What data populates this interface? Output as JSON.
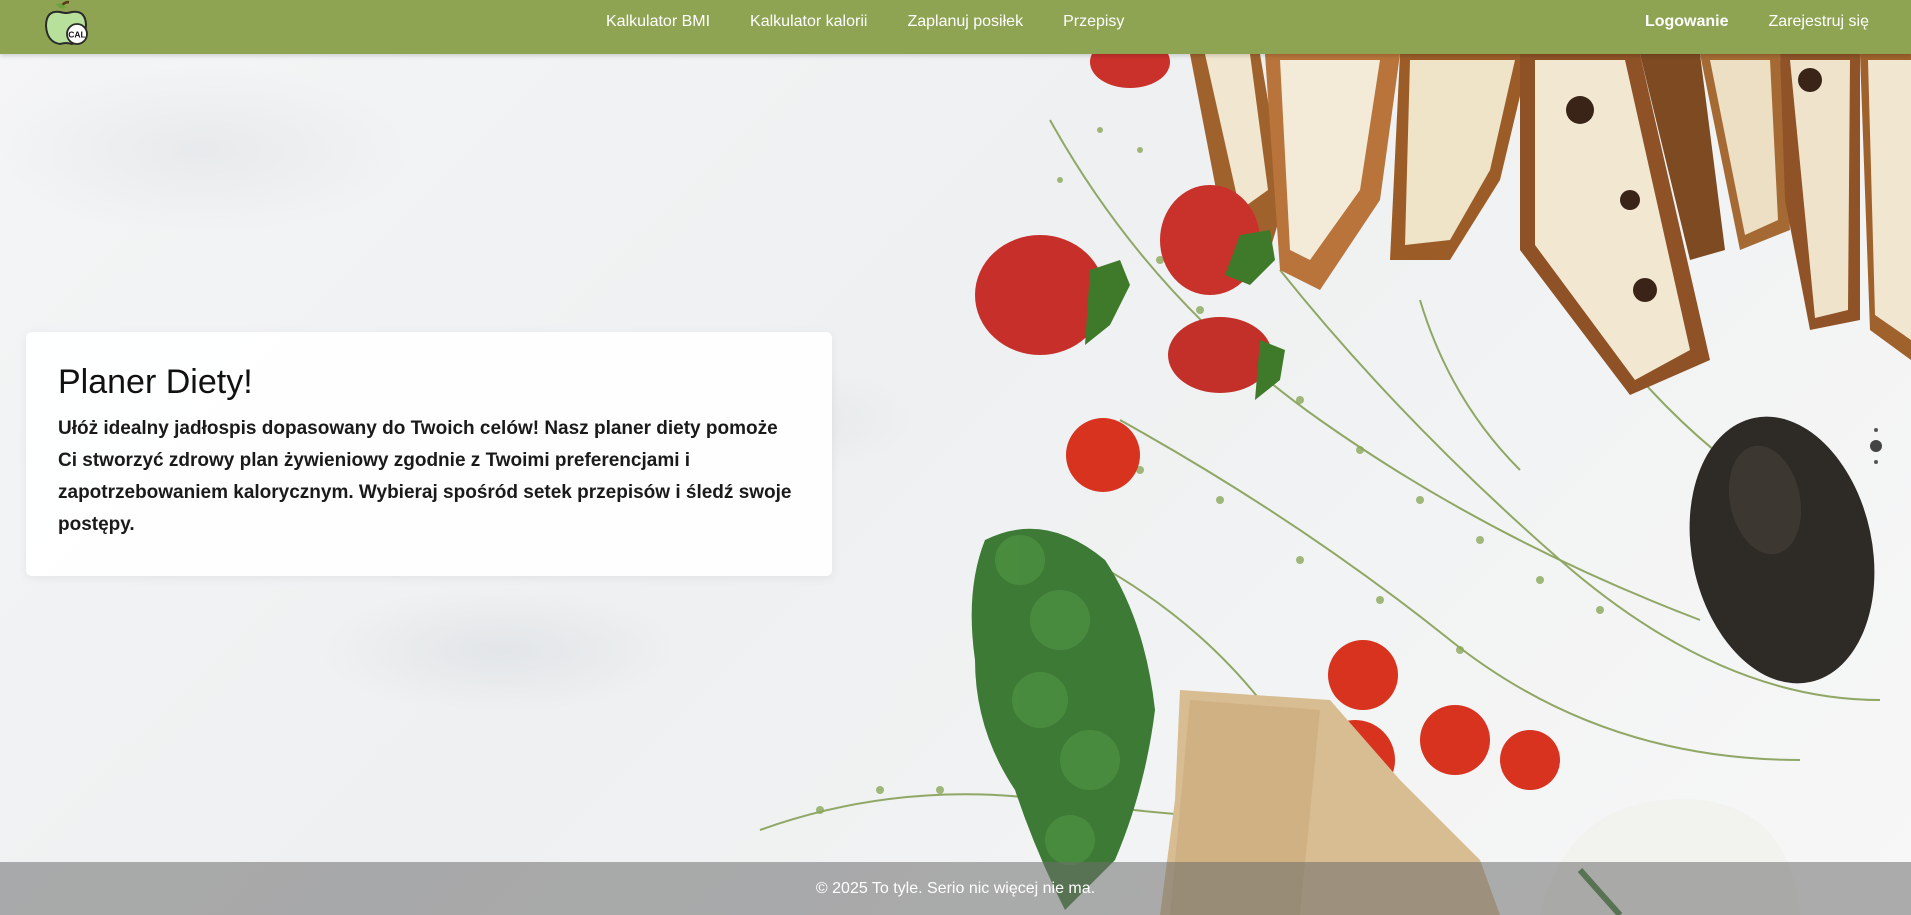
{
  "brand": {
    "logo_text": "CAL",
    "color": "#8ea453"
  },
  "nav": {
    "links": [
      {
        "label": "Kalkulator BMI"
      },
      {
        "label": "Kalkulator kalorii"
      },
      {
        "label": "Zaplanuj posiłek"
      },
      {
        "label": "Przepisy"
      }
    ],
    "login_label": "Logowanie",
    "register_label": "Zarejestruj się"
  },
  "hero": {
    "title": "Planer Diety!",
    "text": "Ułóż idealny jadłospis dopasowany do Twoich celów! Nasz planer diety pomoże Ci stworzyć zdrowy plan żywieniowy zgodnie z Twoimi preferencjami i zapotrzebowaniem kalorycznym. Wybieraj spośród setek przepisów i śledź swoje postępy."
  },
  "carousel": {
    "slides": 3,
    "active_index": 1
  },
  "footer": {
    "text": "© 2025 To tyle. Serio nic więcej nie ma."
  }
}
